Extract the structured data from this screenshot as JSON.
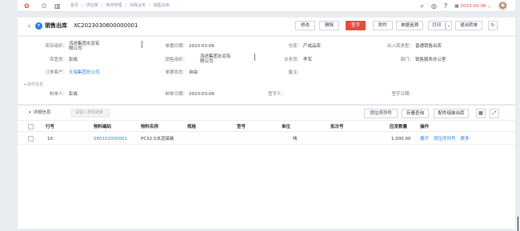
{
  "topbar": {
    "crumbs": [
      "首页",
      "供应链",
      "库存管理",
      "出库业务",
      "销售出库"
    ],
    "date": "2023-03-06"
  },
  "header": {
    "title": "销售出库",
    "doc_no": "XC2023030600000001",
    "buttons": {
      "edit": "修改",
      "delete": "删除",
      "sign": "签字",
      "attach": "附件",
      "trace": "单据追溯",
      "print": "打印",
      "exit": "退出转单"
    }
  },
  "form": {
    "inventory_org": {
      "label": "库存组织：",
      "value": "鸿途集团水泥有限公司"
    },
    "doc_date": {
      "label": "单据日期：",
      "value": "2023-03-06"
    },
    "warehouse": {
      "label": "仓库：",
      "value": "产成品库"
    },
    "out_type": {
      "label": "出入库类型：",
      "value": "普通销售出库"
    },
    "keeper": {
      "label": "库管员：",
      "value": "彭成"
    },
    "sales_org": {
      "label": "销售组织：",
      "value": "鸿途集团水泥有限公司"
    },
    "salesman": {
      "label": "业务员：",
      "value": "李军"
    },
    "department": {
      "label": "部门：",
      "value": "销售服务办公室"
    },
    "customer": {
      "label": "订单客户：",
      "value": "天海集团总公司"
    },
    "doc_status": {
      "label": "单据状态：",
      "value": "自由"
    },
    "remark": {
      "label": "备注：",
      "value": ""
    },
    "section_ops": "操作信息",
    "creator": {
      "label": "制单人：",
      "value": "彭成"
    },
    "create_date": {
      "label": "制单日期：",
      "value": "2023-03-06"
    },
    "signer": {
      "label": "签字人：",
      "value": ""
    },
    "sign_date": {
      "label": "签字日期：",
      "value": ""
    }
  },
  "detail": {
    "tab_label": "详细信息",
    "search_placeholder": "请输入表体搜索",
    "buttons": {
      "serial": "货位序列号",
      "stock": "存量查询",
      "kit": "配件组装出库"
    },
    "columns": [
      "行号",
      "物料编码",
      "物料名称",
      "规格",
      "型号",
      "单位",
      "批次号",
      "应发数量",
      "操作"
    ],
    "rows": [
      {
        "line": "10",
        "code": "060101000001",
        "name": "PC32.5水泥袋装",
        "spec": "",
        "model": "",
        "unit": "吨",
        "batch": "",
        "qty": "1,000.00",
        "ops": [
          "展开",
          "货位序列号",
          "更多"
        ]
      }
    ]
  }
}
